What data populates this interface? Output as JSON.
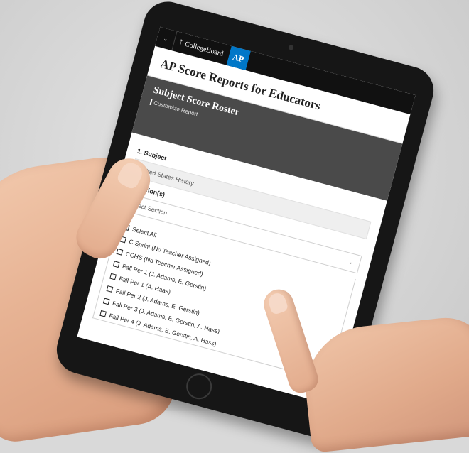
{
  "app": {
    "brand": "CollegeBoard",
    "badge": "AP",
    "page_title": "AP Score Reports for Educators"
  },
  "banner": {
    "title": "Subject Score Roster",
    "breadcrumb": "Customize Report"
  },
  "form": {
    "subject": {
      "label": "1. Subject",
      "value": "United States History"
    },
    "sections": {
      "label": "2. Section(s)",
      "placeholder": "Select Section",
      "options": [
        "Select All",
        "C Sprint (No Teacher Assigned)",
        "CCHS (No Teacher Assigned)",
        "Fall Per 1 (J. Adams, E. Gerstin)",
        "Fall Per 1 (A. Haas)",
        "Fall Per 2 (J. Adams, E. Gerstin)",
        "Fall Per 3 (J. Adams, E. Gerstin, A. Hass)",
        "Fall Per 4 (J. Adams, E. Gerstin, A. Hass)"
      ]
    }
  },
  "colors": {
    "ap_blue": "#0077c8",
    "banner_gray": "#4a4a4a",
    "topbar": "#111111"
  },
  "icons": {
    "menu": "chevron-down-icon",
    "dropdown": "chevron-down-icon",
    "brand": "acorn-logo-icon"
  }
}
